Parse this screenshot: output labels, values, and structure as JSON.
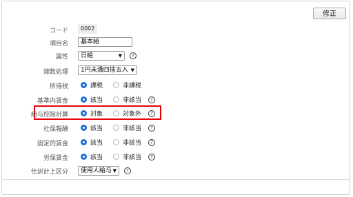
{
  "toolbar": {
    "edit_label": "修正"
  },
  "fields": {
    "code": {
      "label": "コード",
      "value": "0002"
    },
    "item_name": {
      "label": "項目名",
      "value": "基本給"
    },
    "attribute": {
      "label": "属性",
      "value": "日給"
    },
    "rounding": {
      "label": "端数処理",
      "value": "1円未満四捨五入"
    },
    "income_tax": {
      "label": "所得税",
      "option_on": "課税",
      "option_off": "非課税"
    },
    "base_wage": {
      "label": "基準内賃金",
      "option_on": "該当",
      "option_off": "非該当"
    },
    "salary_deduction": {
      "label": "給与控除計算",
      "option_on": "対象",
      "option_off": "対象外"
    },
    "social_insurance": {
      "label": "社保報酬",
      "option_on": "該当",
      "option_off": "非該当"
    },
    "fixed_wage": {
      "label": "固定的賃金",
      "option_on": "該当",
      "option_off": "非該当"
    },
    "labor_insurance": {
      "label": "労保賃金",
      "option_on": "該当",
      "option_off": "非該当"
    },
    "journal_category": {
      "label": "仕訳計上区分",
      "value": "使用人給与"
    }
  },
  "icons": {
    "help": "question-circle-icon",
    "dropdown": "chevron-down-icon"
  },
  "colors": {
    "radio_selected": "#1d6fd1",
    "highlight": "#e8000b"
  }
}
